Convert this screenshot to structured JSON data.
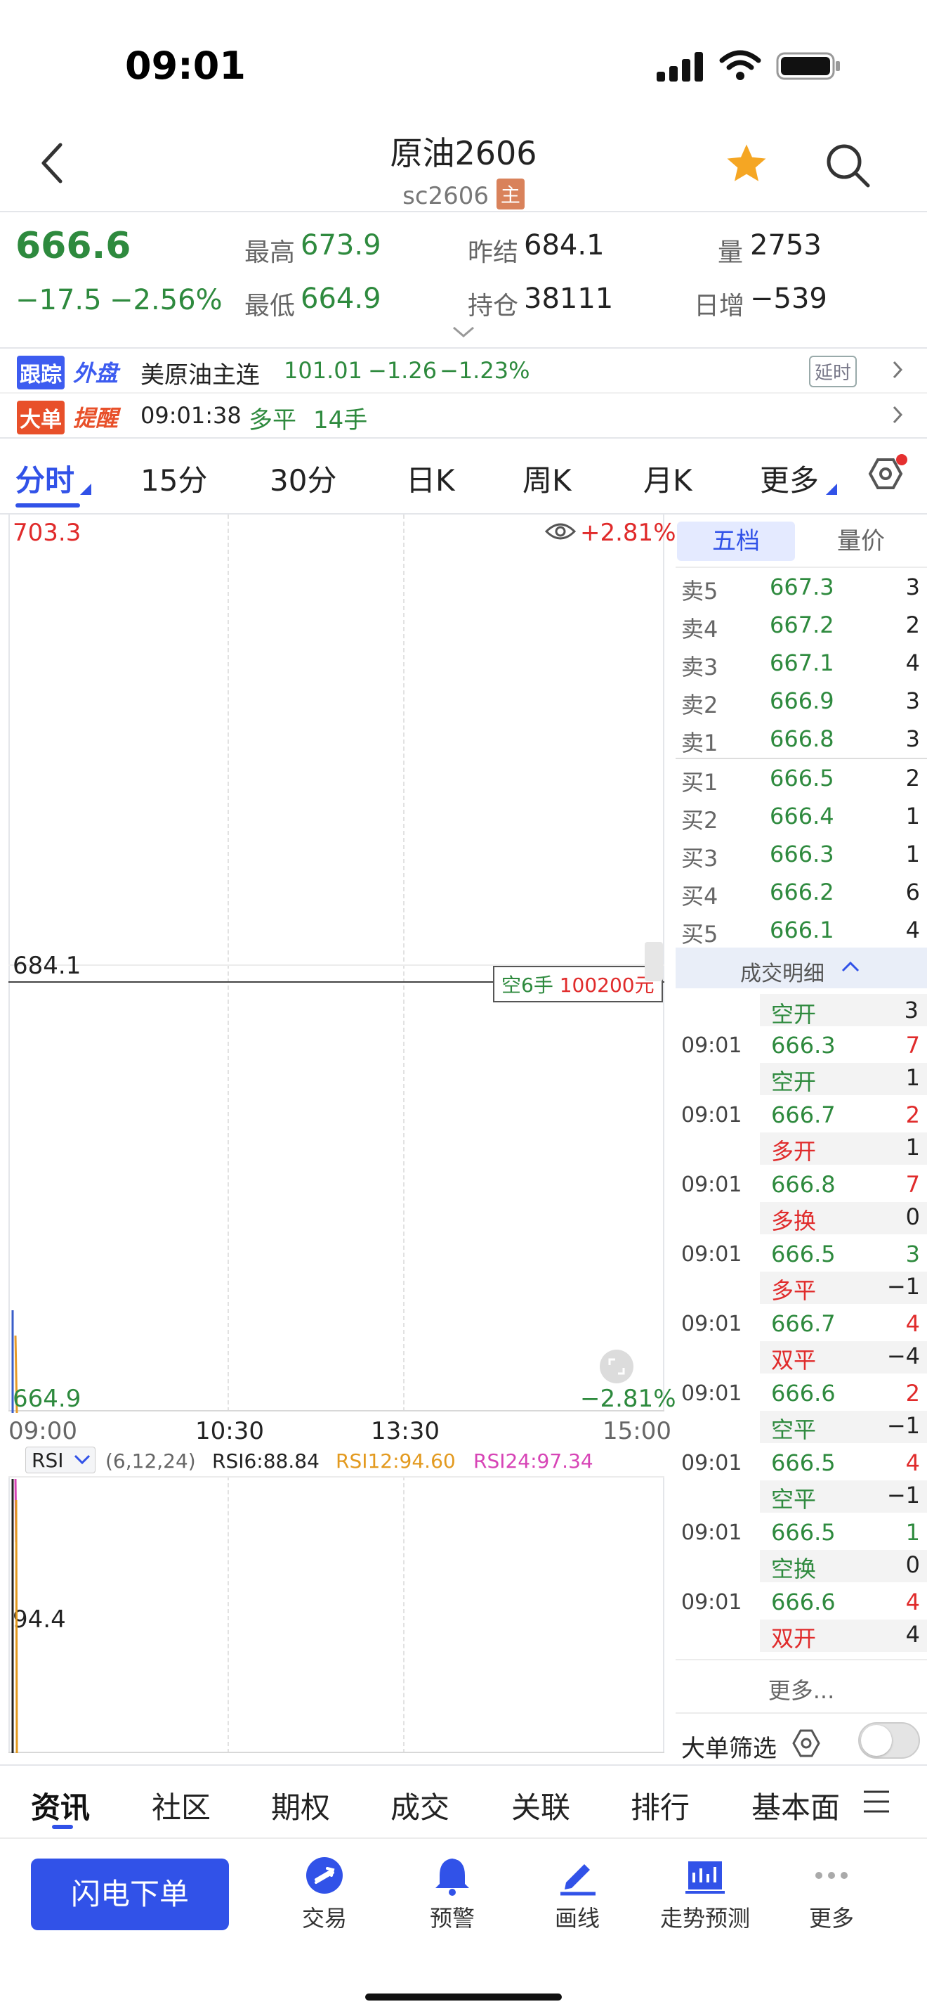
{
  "status_bar": {
    "time": "09:01"
  },
  "header": {
    "title": "原油2606",
    "code": "sc2606",
    "main_badge": "主"
  },
  "quote": {
    "price": "666.6",
    "change": "−17.5",
    "change_pct": "−2.56%",
    "high_label": "最高",
    "high": "673.9",
    "low_label": "最低",
    "low": "664.9",
    "prev_settle_label": "昨结",
    "prev_settle": "684.1",
    "open_interest_label": "持仓",
    "open_interest": "38111",
    "volume_label": "量",
    "volume": "2753",
    "daily_inc_label": "日增",
    "daily_inc": "−539"
  },
  "track": {
    "badge1": "跟踪",
    "badge2": "外盘",
    "name": "美原油主连",
    "price": "101.01",
    "change": "−1.26",
    "pct": "−1.23%",
    "delay": "延时"
  },
  "big_order": {
    "badge1": "大单",
    "badge2": "提醒",
    "time": "09:01:38",
    "type": "多平",
    "lots": "14手"
  },
  "period_tabs": [
    "分时",
    "15分",
    "30分",
    "日K",
    "周K",
    "月K",
    "更多"
  ],
  "chart": {
    "top_price": "703.3",
    "top_pct": "+2.81%",
    "mid_price": "684.1",
    "bottom_price": "664.9",
    "bottom_pct": "−2.81%",
    "times": [
      "09:00",
      "10:30",
      "13:30",
      "15:00"
    ],
    "marker_side": "空6手",
    "marker_amount": "100200元"
  },
  "rsi": {
    "label": "RSI",
    "params": "(6,12,24)",
    "rsi6": "RSI6:88.84",
    "rsi12": "RSI12:94.60",
    "rsi24": "RSI24:97.34",
    "level": "94.4"
  },
  "orderbook": {
    "tabs": [
      "五档",
      "量价"
    ],
    "asks": [
      {
        "label": "卖5",
        "price": "667.3",
        "vol": "3"
      },
      {
        "label": "卖4",
        "price": "667.2",
        "vol": "2"
      },
      {
        "label": "卖3",
        "price": "667.1",
        "vol": "4"
      },
      {
        "label": "卖2",
        "price": "666.9",
        "vol": "3"
      },
      {
        "label": "卖1",
        "price": "666.8",
        "vol": "3"
      }
    ],
    "bids": [
      {
        "label": "买1",
        "price": "666.5",
        "vol": "2"
      },
      {
        "label": "买2",
        "price": "666.4",
        "vol": "1"
      },
      {
        "label": "买3",
        "price": "666.3",
        "vol": "1"
      },
      {
        "label": "买4",
        "price": "666.2",
        "vol": "6"
      },
      {
        "label": "买5",
        "price": "666.1",
        "vol": "4"
      }
    ]
  },
  "trades": {
    "title": "成交明细",
    "first_type": "空开",
    "first_chg": "3",
    "rows": [
      {
        "time": "09:01",
        "price": "666.3",
        "vol": "7",
        "type": "空开",
        "chg": "1"
      },
      {
        "time": "09:01",
        "price": "666.7",
        "vol": "2",
        "type": "多开",
        "chg": "1"
      },
      {
        "time": "09:01",
        "price": "666.8",
        "vol": "7",
        "type": "多换",
        "chg": "0"
      },
      {
        "time": "09:01",
        "price": "666.5",
        "vol": "3",
        "type": "多平",
        "chg": "−1"
      },
      {
        "time": "09:01",
        "price": "666.7",
        "vol": "4",
        "type": "双平",
        "chg": "−4"
      },
      {
        "time": "09:01",
        "price": "666.6",
        "vol": "2",
        "type": "空平",
        "chg": "−1"
      },
      {
        "time": "09:01",
        "price": "666.5",
        "vol": "4",
        "type": "空平",
        "chg": "−1"
      },
      {
        "time": "09:01",
        "price": "666.5",
        "vol": "1",
        "type": "空换",
        "chg": "0"
      },
      {
        "time": "09:01",
        "price": "666.6",
        "vol": "4",
        "type": "双开",
        "chg": "4"
      }
    ],
    "more": "更多...",
    "filter_label": "大单筛选"
  },
  "bottom_tabs": [
    "资讯",
    "社区",
    "期权",
    "成交",
    "关联",
    "排行",
    "基本面"
  ],
  "action_bar": {
    "flash_order": "闪电下单",
    "items": [
      "交易",
      "预警",
      "画线",
      "走势预测",
      "更多"
    ]
  },
  "colors": {
    "accent": "#3152e8",
    "up": "#e02b2b",
    "down": "#2e8a3e",
    "star": "#f5a623"
  }
}
